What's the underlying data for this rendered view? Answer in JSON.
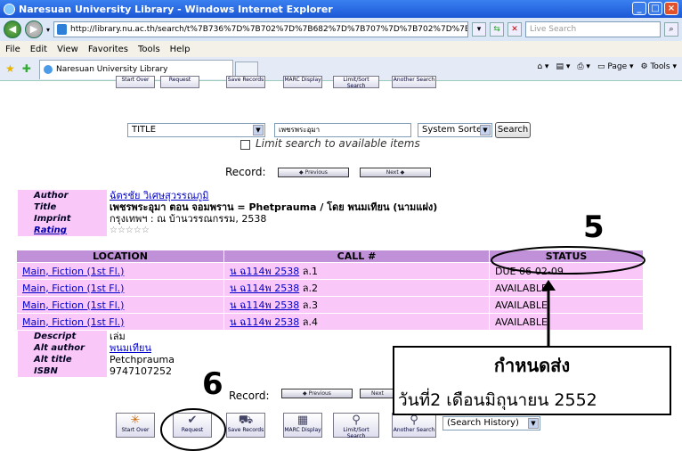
{
  "window": {
    "title": "Naresuan University Library - Windows Internet Explorer"
  },
  "address": {
    "url": "http://library.nu.ac.th/search/t%7B736%7D%7B702%7D%7B682%7D%7B707%7D%7B702%7D%7B707%7D%7B720%7",
    "search_placeholder": "Live Search"
  },
  "menu": [
    "File",
    "Edit",
    "View",
    "Favorites",
    "Tools",
    "Help"
  ],
  "tab": {
    "title": "Naresuan University Library"
  },
  "toolbar": {
    "page": "Page",
    "tools": "Tools"
  },
  "top_buttons": [
    "Start Over",
    "Request",
    "Save Records",
    "MARC Display",
    "Limit/Sort Search",
    "Another Search"
  ],
  "search": {
    "field": "TITLE",
    "query": "เพชรพระอุมา",
    "sort": "System Sorted",
    "button": "Search",
    "limit_label": "Limit search to available items"
  },
  "record": {
    "label": "Record:",
    "prev": "Previous",
    "next": "Next"
  },
  "bib": {
    "author_label": "Author",
    "author": "ฉัตรชัย วิเศษสุวรรณภูมิ",
    "title_label": "Title",
    "title": "เพชรพระอุมา ตอน จอมพราน = Phetpraumа / โดย พนมเทียน (นามแฝง)",
    "imprint_label": "Imprint",
    "imprint": "กรุงเทพฯ : ณ บ้านวรรณกรรม, 2538",
    "rating_label": "Rating",
    "rating": "☆☆☆☆☆"
  },
  "holdings": {
    "headers": [
      "LOCATION",
      "CALL #",
      "STATUS"
    ],
    "rows": [
      {
        "location": "Main, Fiction (1st Fl.)",
        "call": "น ฉ114พ 2538",
        "vol": "ล.1",
        "status": "DUE 06-02-09"
      },
      {
        "location": "Main, Fiction (1st Fl.)",
        "call": "น ฉ114พ 2538",
        "vol": "ล.2",
        "status": "AVAILABLE"
      },
      {
        "location": "Main, Fiction (1st Fl.)",
        "call": "น ฉ114พ 2538",
        "vol": "ล.3",
        "status": "AVAILABLE"
      },
      {
        "location": "Main, Fiction (1st Fl.)",
        "call": "น ฉ114พ 2538",
        "vol": "ล.4",
        "status": "AVAILABLE"
      }
    ]
  },
  "bib2": {
    "descript_label": "Descript",
    "descript": "เล่ม",
    "altauthor_label": "Alt author",
    "altauthor": "พนมเทียน",
    "alttitle_label": "Alt title",
    "alttitle": "Petchprauma",
    "isbn_label": "ISBN",
    "isbn": "9747107252"
  },
  "bottom": {
    "search_history": "(Search History)"
  },
  "annotations": {
    "num5": "5",
    "num6": "6",
    "box_line1": "กำหนดส่ง",
    "box_line2": "วันที่2  เดือนมิถุนายน  2552"
  }
}
